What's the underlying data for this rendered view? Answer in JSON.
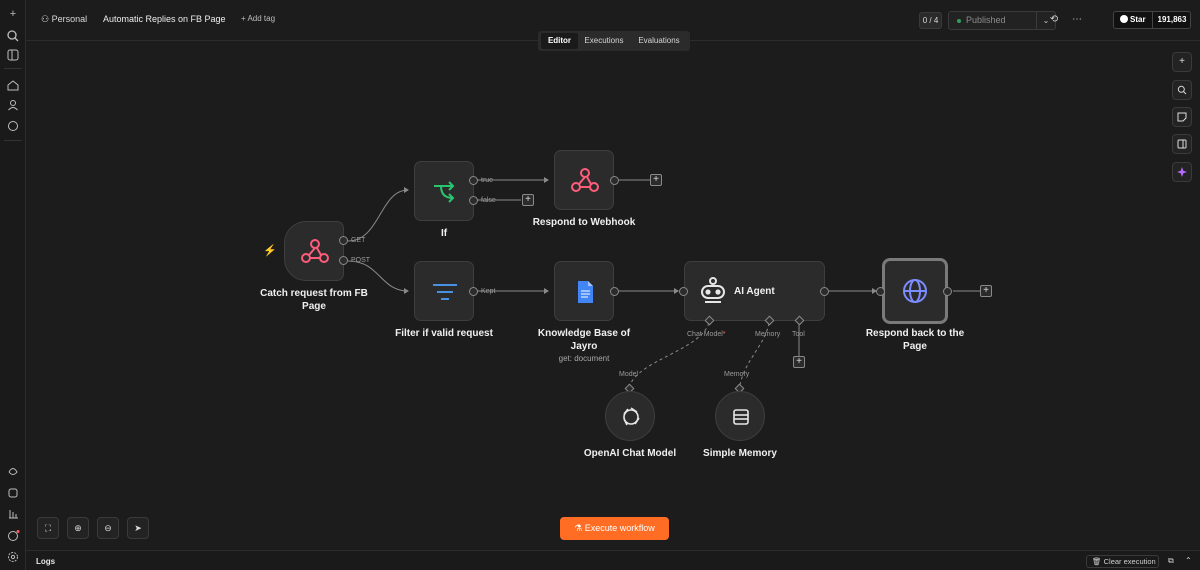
{
  "header": {
    "project": "Personal",
    "workflow_title": "Automatic Replies on FB Page",
    "add_tag": "+ Add tag",
    "counter": "0 / 4",
    "status": "Published",
    "github": {
      "star_label": "Star",
      "star_count": "191,863"
    }
  },
  "tabs": [
    {
      "label": "Editor",
      "active": true
    },
    {
      "label": "Executions",
      "active": false
    },
    {
      "label": "Evaluations",
      "active": false
    }
  ],
  "nodes": {
    "trigger": {
      "label": "Catch request from FB Page",
      "icon": "webhook-icon",
      "outputs": [
        "GET",
        "POST"
      ]
    },
    "if": {
      "label": "If",
      "icon": "branch-icon",
      "outputs": [
        "true",
        "false"
      ]
    },
    "respond_webhook": {
      "label": "Respond to Webhook",
      "icon": "webhook-icon"
    },
    "filter": {
      "label": "Filter if valid request",
      "icon": "filter-icon",
      "output": "Kept"
    },
    "knowledge_base": {
      "label": "Knowledge Base of Jayro",
      "sub": "get: document",
      "icon": "google-docs-icon"
    },
    "ai_agent": {
      "label": "AI Agent",
      "icon": "robot-icon",
      "ports": [
        "Chat Model",
        "Memory",
        "Tool"
      ]
    },
    "respond_page": {
      "label": "Respond back to the Page",
      "icon": "globe-icon"
    },
    "openai": {
      "label": "OpenAI Chat Model",
      "port": "Model",
      "icon": "openai-icon"
    },
    "memory": {
      "label": "Simple Memory",
      "port": "Memory",
      "icon": "database-icon"
    }
  },
  "footer": {
    "execute": "Execute workflow",
    "logs": "Logs",
    "clear": "Clear execution"
  },
  "colors": {
    "accent": "#ff6d24",
    "published_dot": "#2f9e5d",
    "webhook": "#ff5c7a",
    "if_green": "#28c66f",
    "filter_blue": "#4a90e2",
    "gdoc_blue": "#4285f4",
    "globe_blue": "#7b8cff"
  }
}
